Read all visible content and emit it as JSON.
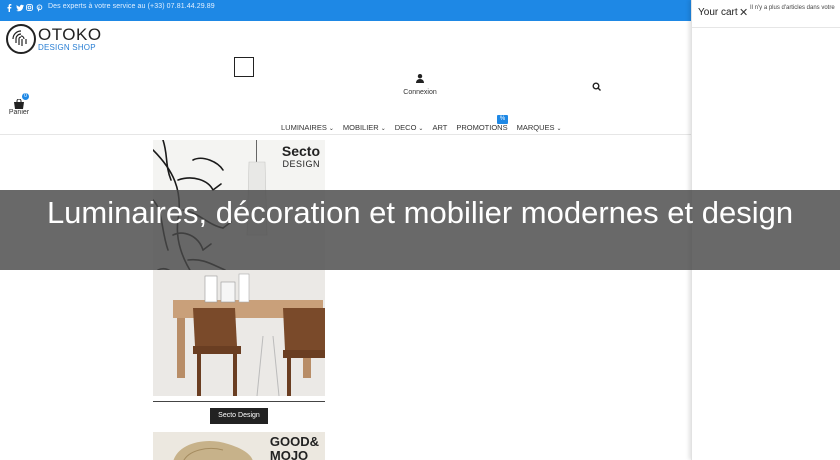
{
  "topbar": {
    "info": "Des experts à votre service au (+33) 07.81.44.29.89",
    "social_icons": [
      "facebook-icon",
      "twitter-icon",
      "instagram-icon",
      "pinterest-icon"
    ],
    "color": "#1e88e5"
  },
  "logo": {
    "name": "OTOKO",
    "tagline": "DESIGN SHOP"
  },
  "header": {
    "account_label": "Connexion",
    "cart_label": "Panier",
    "cart_count": "0"
  },
  "nav": {
    "items": [
      {
        "label": "LUMINAIRES",
        "has_dropdown": true
      },
      {
        "label": "MOBILIER",
        "has_dropdown": true
      },
      {
        "label": "DECO",
        "has_dropdown": true
      },
      {
        "label": "ART",
        "has_dropdown": false
      },
      {
        "label": "PROMOTIONS",
        "has_dropdown": false
      },
      {
        "label": "MARQUES",
        "has_dropdown": true
      }
    ],
    "promo_badge": "%"
  },
  "products": [
    {
      "brand_title": "Secto",
      "brand_sub": "DESIGN",
      "button": "Secto Design"
    },
    {
      "brand_title": "GOOD&",
      "brand_sub": "MOJO"
    }
  ],
  "drawer": {
    "title": "Your cart",
    "message": "Il n'y a plus d'articles dans votre",
    "close_icon": "close-icon"
  },
  "banner": {
    "title": "Luminaires, décoration et mobilier modernes et design"
  },
  "colors": {
    "accent": "#1e88e5",
    "dark": "#222222",
    "overlay": "#484848"
  }
}
